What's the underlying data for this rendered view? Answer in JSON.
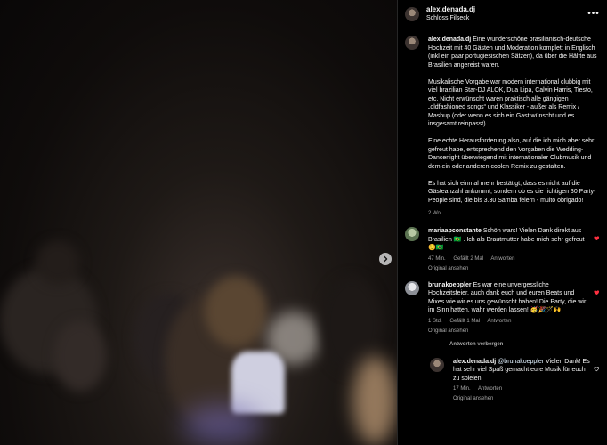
{
  "colors": {
    "background": "#000000",
    "text": "#f5f5f5",
    "secondary": "#a8a8a8",
    "like_active": "#ff3040",
    "divider": "#262626"
  },
  "media": {
    "next_icon": "chevron-right-icon"
  },
  "header": {
    "username": "alex.denada.dj",
    "location": "Schloss Filseck",
    "more_icon": "more-options-icon"
  },
  "caption": {
    "username": "alex.denada.dj",
    "paragraphs": [
      "Eine wunderschöne brasilianisch-deutsche Hochzeit mit 40 Gästen und Moderation komplett in Englisch (inkl ein paar portugiesischen Sätzen), da über die Hälfte aus Brasilien angereist waren.",
      "Musikalische Vorgabe war modern international clubbig mit viel brazilian Star-DJ ALOK, Dua Lipa, Calvin Harris, Tiesto, etc. Nicht erwünscht waren praktisch alle gängigen „oldfashioned songs“ und Klassiker - außer als Remix / Mashup (oder wenn es sich ein Gast wünscht und es insgesamt reinpasst).",
      "Eine echte Herausforderung also, auf die ich mich aber sehr gefreut habe, entsprechend den Vorgaben die Wedding-Dancenight überwiegend mit internationaler Clubmusik und dem ein oder anderen coolen Remix zu gestalten.",
      "Es hat sich einmal mehr bestätigt, dass es nicht auf die Gästeanzahl ankommt, sondern ob es die richtigen 30 Party-People sind, die bis 3.30 Samba feiern - muito obrigado!"
    ],
    "time": "2 Wo."
  },
  "comments": [
    {
      "username": "mariaapconstante",
      "text": "Schön wars! Vielen Dank direkt aus Brasilien 🇧🇷 . Ich als Brautmutter habe mich sehr gefreut ☺️🇧🇷",
      "time": "47 Min.",
      "likes": "Gefällt 2 Mal",
      "reply": "Antworten",
      "see_original": "Original ansehen",
      "liked": true
    },
    {
      "username": "brunakoeppler",
      "text": "Es war eine unvergessliche Hochzeitsfeier, auch dank euch und euren Beats und Mixes wie wir es uns gewünscht haben! Die Party, die wir im Sinn hatten, wahr werden lassen! 🥳🎉🪄🙌",
      "time": "1 Std.",
      "likes": "Gefällt 1 Mal",
      "reply": "Antworten",
      "see_original": "Original ansehen",
      "liked": true
    }
  ],
  "replies_toggle": "Antworten verbergen",
  "reply": {
    "username": "alex.denada.dj",
    "mention": "@brunakoeppler",
    "text": "Vielen Dank! Es hat sehr viel Spaß gemacht eure Musik für euch zu spielen!",
    "time": "17 Min.",
    "reply": "Antworten",
    "see_original": "Original ansehen",
    "liked": false
  }
}
